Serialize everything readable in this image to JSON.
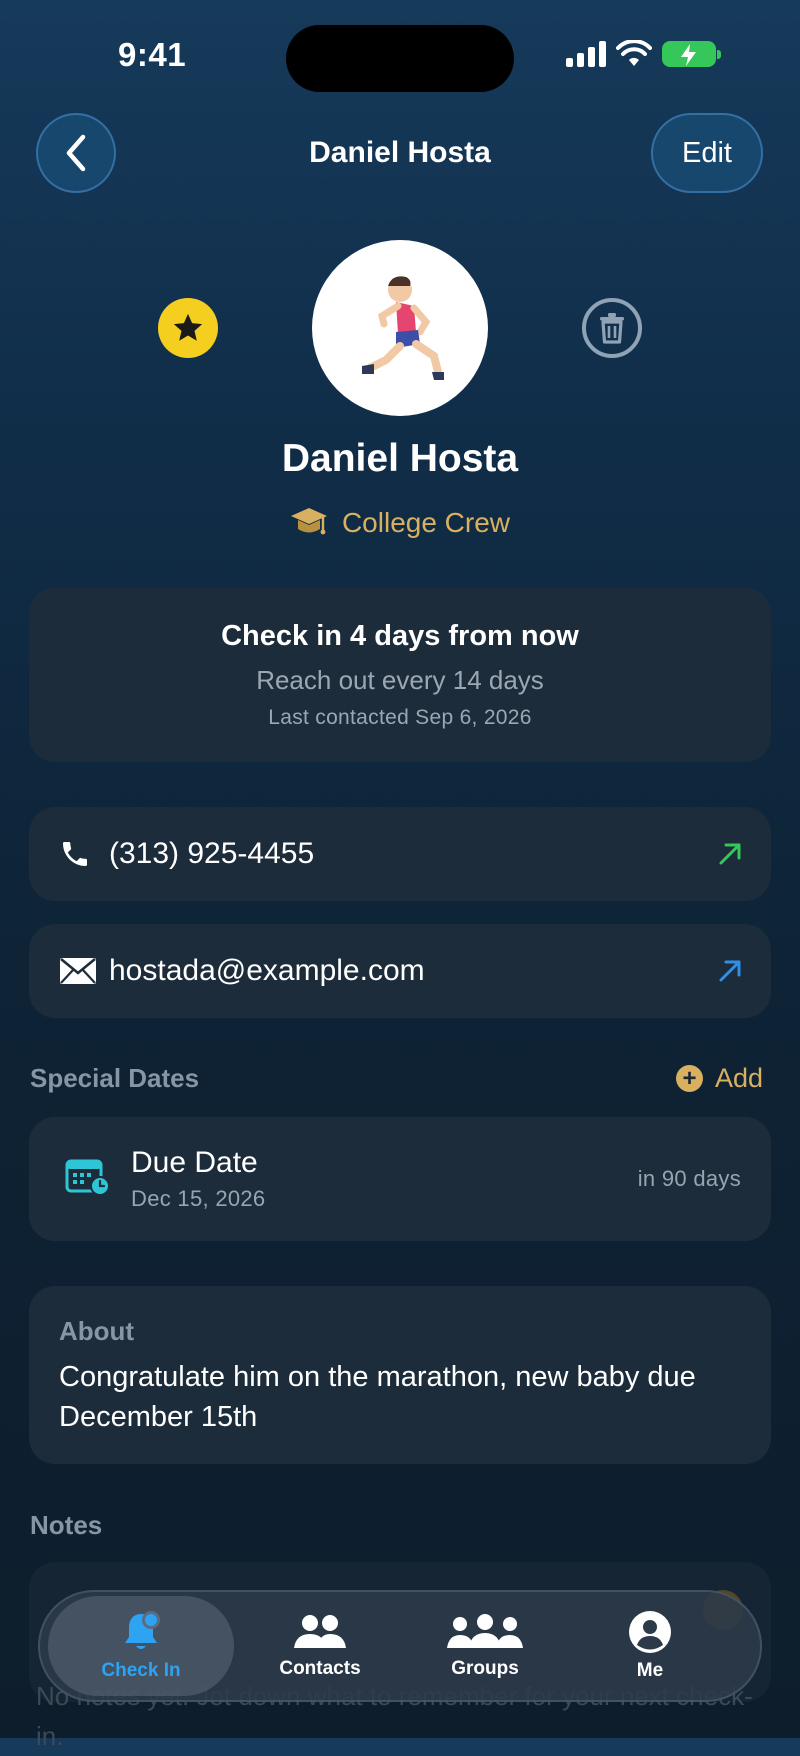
{
  "status_bar": {
    "time": "9:41"
  },
  "nav": {
    "title": "Daniel Hosta",
    "edit_label": "Edit"
  },
  "profile": {
    "name": "Daniel Hosta",
    "group": "College Crew",
    "avatar_emoji": "🏃🏻‍♂️"
  },
  "checkin": {
    "title": "Check in 4 days from now",
    "frequency": "Reach out every 14 days",
    "last_contacted": "Last contacted Sep 6, 2026"
  },
  "contact": {
    "phone": "(313) 925-4455",
    "email": "hostada@example.com"
  },
  "special_dates": {
    "label": "Special Dates",
    "add_label": "Add",
    "items": [
      {
        "title": "Due Date",
        "date": "Dec 15, 2026",
        "relative": "in 90 days"
      }
    ]
  },
  "about": {
    "label": "About",
    "text": "Congratulate him on the marathon, new baby due December 15th"
  },
  "notes": {
    "label": "Notes",
    "hint": "No notes yet. Jot down what to remember for your next check-in."
  },
  "tabbar": {
    "tabs": [
      {
        "label": "Check In",
        "active": true
      },
      {
        "label": "Contacts"
      },
      {
        "label": "Groups"
      },
      {
        "label": "Me"
      }
    ]
  },
  "colors": {
    "accent_gold": "#d8b060",
    "active_tab": "#2ea3f2",
    "phone_arrow": "#35c759",
    "email_arrow": "#2f8fe8",
    "favorite": "#f5cf1f"
  }
}
